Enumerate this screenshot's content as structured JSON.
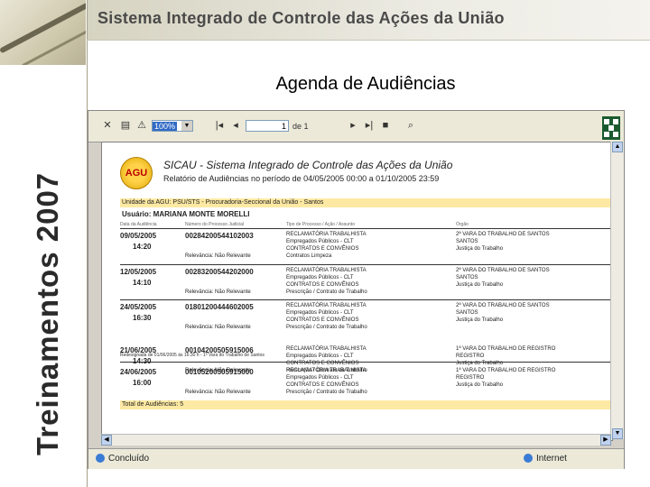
{
  "header": {
    "title": "Sistema Integrado de Controle das Ações da União"
  },
  "side_label": "Treinamentos 2007",
  "slide_title": "Agenda de Audiências",
  "viewer": {
    "zoom_value": "100%",
    "page_value": "1",
    "page_suffix": "de 1",
    "status_left": "Concluído",
    "status_right": "Internet"
  },
  "report": {
    "logo_text": "AGU",
    "title": "SICAU - Sistema Integrado de Controle das Ações da União",
    "subtitle": "Relatório de Audiências no período de 04/05/2005 00:00 a 01/10/2005 23:59",
    "unit": "Unidade da AGU: PSU/STS - Procuradoria-Seccional da União - Santos",
    "user": "Usuário: MARIANA MONTE MORELLI",
    "col_headers": [
      "Data da Audiência",
      "Número do Processo Judicial",
      "Tipo de Processo / Ação / Assunto",
      "Órgão"
    ],
    "records": [
      {
        "date": "09/05/2005",
        "time": "14:20",
        "proc": "00284200544102003",
        "rel": "Relevância: Não Relevante",
        "t": [
          "RECLAMATÓRIA TRABALHISTA",
          "Empregados Públicos - CLT",
          "CONTRATOS E CONVÊNIOS",
          "Contratos Limpeza"
        ],
        "l": [
          "2ª VARA DO TRABALHO DE SANTOS",
          "SANTOS",
          "Justiça do Trabalho"
        ]
      },
      {
        "date": "12/05/2005",
        "time": "14:10",
        "proc": "00283200544202000",
        "rel": "Relevância: Não Relevante",
        "t": [
          "RECLAMATÓRIA TRABALHISTA",
          "Empregados Públicos - CLT",
          "CONTRATOS E CONVÊNIOS",
          "Prescrição / Contrato de Trabalho"
        ],
        "l": [
          "2ª VARA DO TRABALHO DE SANTOS",
          "SANTOS",
          "Justiça do Trabalho"
        ]
      },
      {
        "date": "24/05/2005",
        "time": "16:30",
        "proc": "01801200444602005",
        "rel": "Relevância: Não Relevante",
        "t": [
          "RECLAMATÓRIA TRABALHISTA",
          "Empregados Públicos - CLT",
          "CONTRATOS E CONVÊNIOS",
          "Prescrição / Contrato de Trabalho"
        ],
        "l": [
          "2ª VARA DO TRABALHO DE SANTOS",
          "SANTOS",
          "Justiça do Trabalho"
        ]
      },
      {
        "date": "21/06/2005",
        "time": "14:30",
        "proc": "00104200505915006",
        "rel": "Relevância: Não Relevante",
        "t": [
          "RECLAMATÓRIA TRABALHISTA",
          "Empregados Públicos - CLT",
          "CONTRATOS E CONVÊNIOS",
          "Prescrição / Contrato de Trabalho"
        ],
        "l": [
          "1ª VARA DO TRABALHO DE REGISTRO",
          "REGISTRO",
          "Justiça do Trabalho"
        ]
      },
      {
        "date": "24/06/2005",
        "time": "16:00",
        "proc": "00105200505915000",
        "rel": "Relevância: Não Relevante",
        "t": [
          "RECLAMATÓRIA TRABALHISTA",
          "Empregados Públicos - CLT",
          "CONTRATOS E CONVÊNIOS",
          "Prescrição / Contrato de Trabalho"
        ],
        "l": [
          "1ª VARA DO TRABALHO DE REGISTRO",
          "REGISTRO",
          "Justiça do Trabalho"
        ]
      }
    ],
    "note": "Redesignada de 01/06/2005 às 16:30 h - 1ª Vara do Trabalho de Santos",
    "total": "Total de Audiências: 5"
  }
}
